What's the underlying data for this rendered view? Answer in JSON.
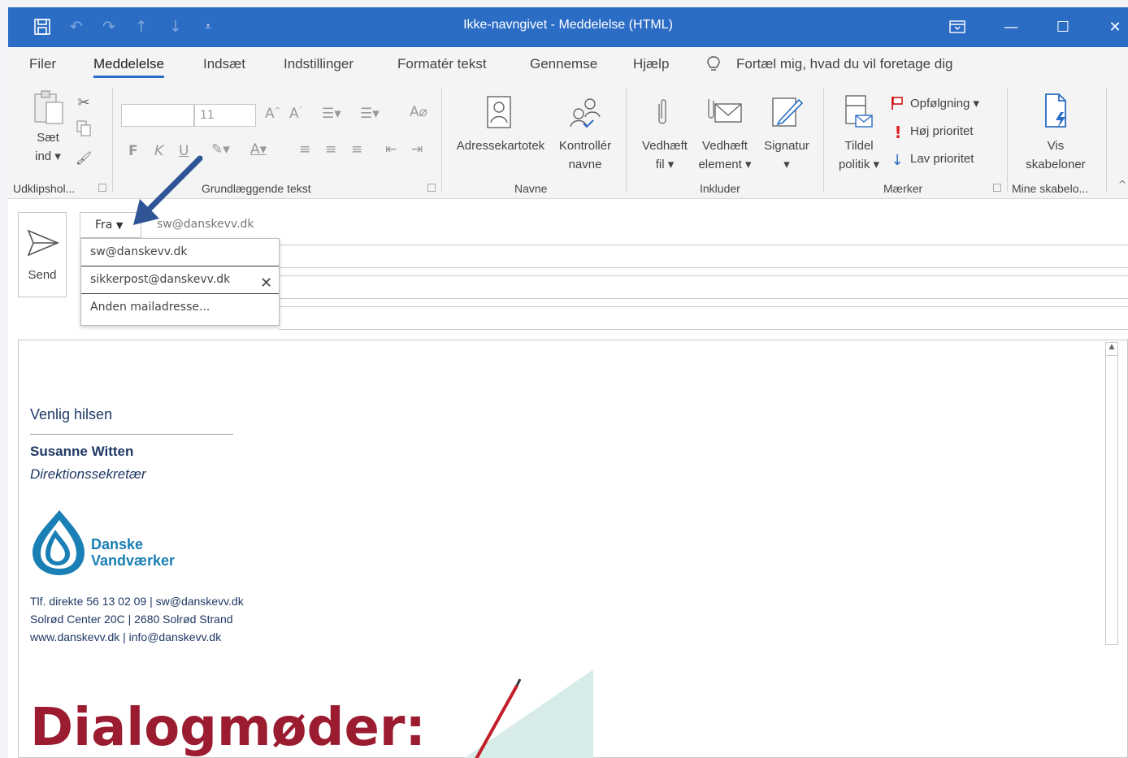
{
  "window": {
    "title": "Ikke-navngivet  -  Meddelelse (HTML)"
  },
  "tabs": [
    {
      "label": "Filer"
    },
    {
      "label": "Meddelelse"
    },
    {
      "label": "Indsæt"
    },
    {
      "label": "Indstillinger"
    },
    {
      "label": "Formatér tekst"
    },
    {
      "label": "Gennemse"
    },
    {
      "label": "Hjælp"
    }
  ],
  "tellme": "Fortæl mig, hvad du vil foretage dig",
  "ribbon": {
    "clipboard": {
      "paste_line1": "Sæt",
      "paste_line2": "ind",
      "group": "Udklipshol..."
    },
    "basic_text": {
      "font_size": "11",
      "bold": "F",
      "italic": "K",
      "underline": "U",
      "group": "Grundlæggende tekst"
    },
    "names": {
      "addressbook": "Adressekartotek",
      "check_line1": "Kontrollér",
      "check_line2": "navne",
      "group": "Navne"
    },
    "include": {
      "attach_file_1": "Vedhæft",
      "attach_file_2": "fil",
      "attach_item_1": "Vedhæft",
      "attach_item_2": "element",
      "signature": "Signatur",
      "group": "Inkluder"
    },
    "tags": {
      "policy_1": "Tildel",
      "policy_2": "politik",
      "followup": "Opfølgning",
      "high": "Høj prioritet",
      "low": "Lav prioritet",
      "group": "Mærker"
    },
    "templates": {
      "view_1": "Vis",
      "view_2": "skabeloner",
      "group": "Mine skabelo..."
    }
  },
  "compose": {
    "send_label": "Send",
    "from_label": "Fra",
    "from_value": "sw@danskevv.dk",
    "from_options": [
      "sw@danskevv.dk",
      "sikkerpost@danskevv.dk",
      "Anden mailadresse..."
    ]
  },
  "signature": {
    "greeting": "Venlig hilsen",
    "name": "Susanne Witten",
    "role": "Direktionssekretær",
    "logo_line1": "Danske",
    "logo_line2": "Vandværker",
    "contact1": "Tlf. direkte 56 13 02 09 | sw@danskevv.dk",
    "contact2": "Solrød Center 20C | 2680 Solrød Strand",
    "contact3": "www.danskevv.dk | info@danskevv.dk",
    "banner": "Dialogmøder:"
  },
  "colors": {
    "accent": "#2b6cc4",
    "signature_text": "#1f3864",
    "banner": "#9b1b30",
    "logo": "#1a7fb4"
  }
}
